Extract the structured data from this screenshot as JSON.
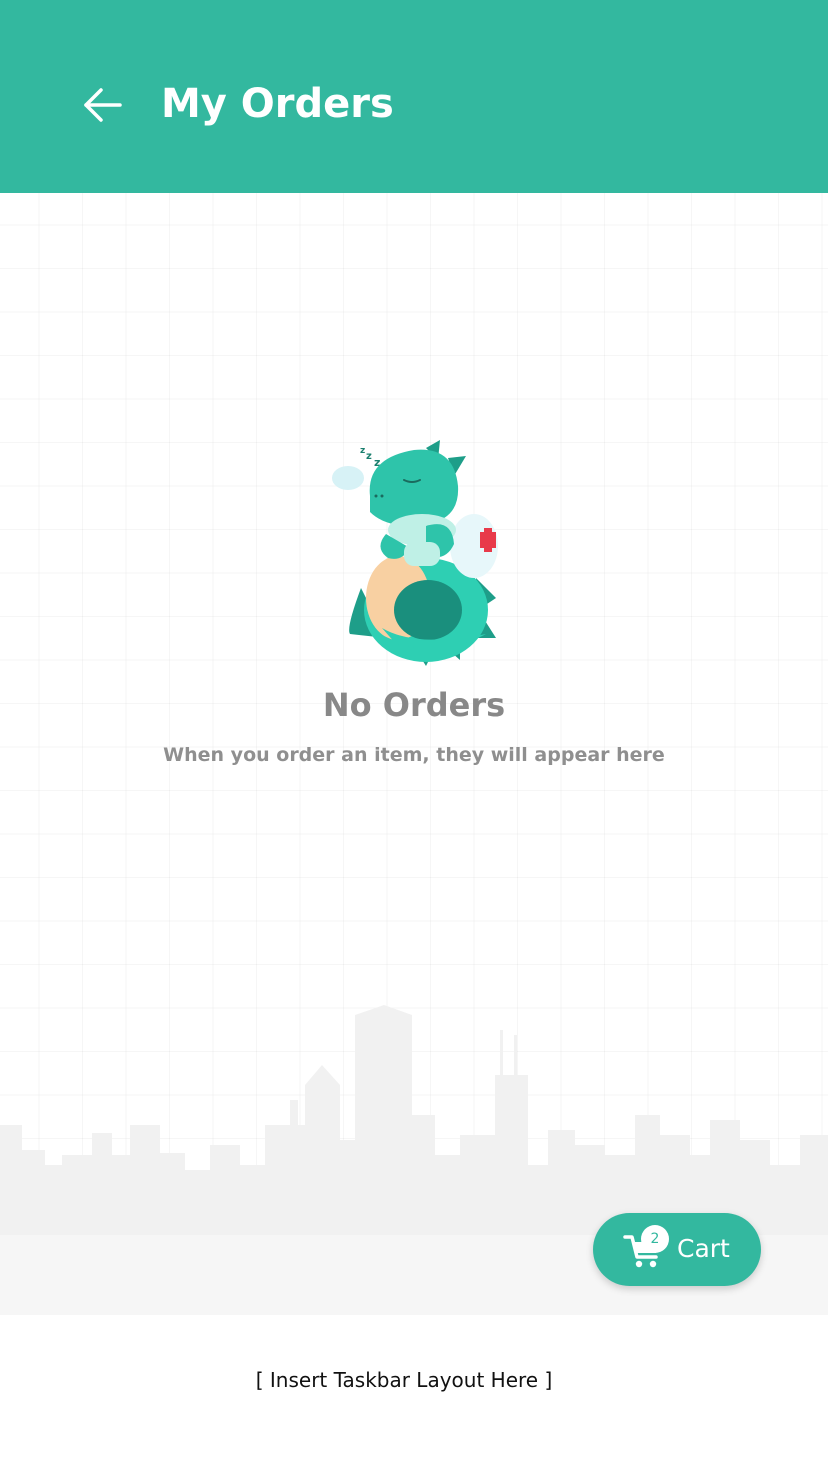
{
  "header": {
    "back_icon": "arrow-left-icon",
    "title": "My Orders"
  },
  "empty_state": {
    "illustration": "sleeping-dinosaur-illustration",
    "title": "No Orders",
    "subtitle": "When you order an item, they will appear here"
  },
  "background": {
    "decoration": "city-skyline-silhouette"
  },
  "cart_button": {
    "icon": "cart-icon",
    "count": "2",
    "label": "Cart"
  },
  "taskbar": {
    "placeholder": "[ Insert Taskbar Layout Here ]"
  },
  "colors": {
    "primary": "#33b89f",
    "muted_text": "#888888",
    "background": "#ffffff"
  }
}
